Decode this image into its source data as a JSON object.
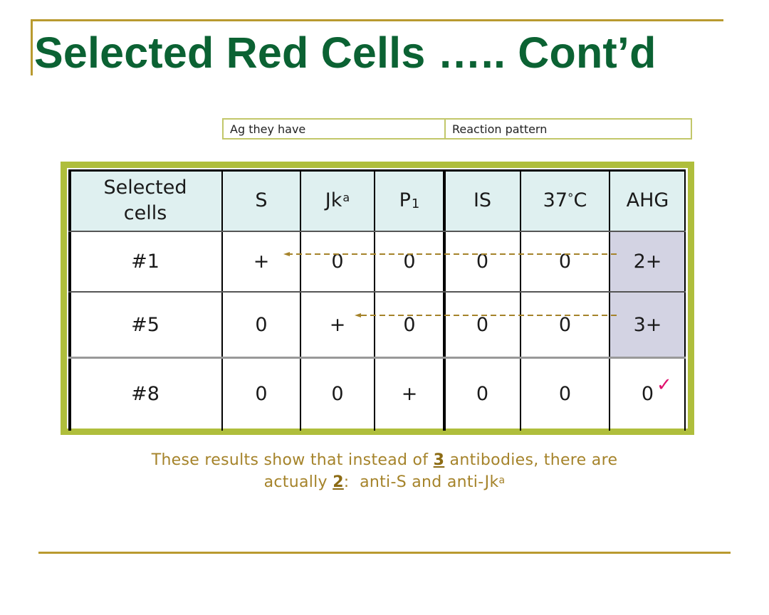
{
  "slide": {
    "title": "Selected Red Cells ….. Cont’d",
    "accent_colors": {
      "title_green": "#0b6233",
      "rule_gold": "#b99a2f",
      "frame_olive": "#afbe3c",
      "header_fill": "#dff0f0",
      "ahg_highlight": "#d3d3e3",
      "summary_text": "#a5832a",
      "check_mark": "#e0116d"
    }
  },
  "legend_table": {
    "col1": "Ag they have",
    "col2": "Reaction pattern"
  },
  "table": {
    "headers": {
      "cells_line1": "Selected",
      "cells_line2": "cells",
      "s": "S",
      "jka_base": "Jk",
      "jka_sup": "a",
      "p1_base": "P",
      "p1_sub": "1",
      "is": "IS",
      "t37_num": "37",
      "t37_deg": "°",
      "t37_unit": "C",
      "ahg": "AHG"
    },
    "rows": [
      {
        "cell": "#1",
        "S": "+",
        "Jka": "0",
        "P1": "0",
        "IS": "0",
        "T37": "0",
        "AHG": "2+",
        "ahg_highlighted": true,
        "arrow_to": "S"
      },
      {
        "cell": "#5",
        "S": "0",
        "Jka": "+",
        "P1": "0",
        "IS": "0",
        "T37": "0",
        "AHG": "3+",
        "ahg_highlighted": true,
        "arrow_to": "Jka"
      },
      {
        "cell": "#8",
        "S": "0",
        "Jka": "0",
        "P1": "+",
        "IS": "0",
        "T37": "0",
        "AHG": "0",
        "ahg_highlighted": false,
        "check_icon": "checkmark-icon"
      }
    ]
  },
  "summary": {
    "line1_pre": "These results show that instead of ",
    "line1_num": "3",
    "line1_post": " antibodies, there are",
    "line2_pre": "actually ",
    "line2_num": "2",
    "line2_post": ":  anti-S and anti-Jk",
    "line2_sup": "a"
  }
}
